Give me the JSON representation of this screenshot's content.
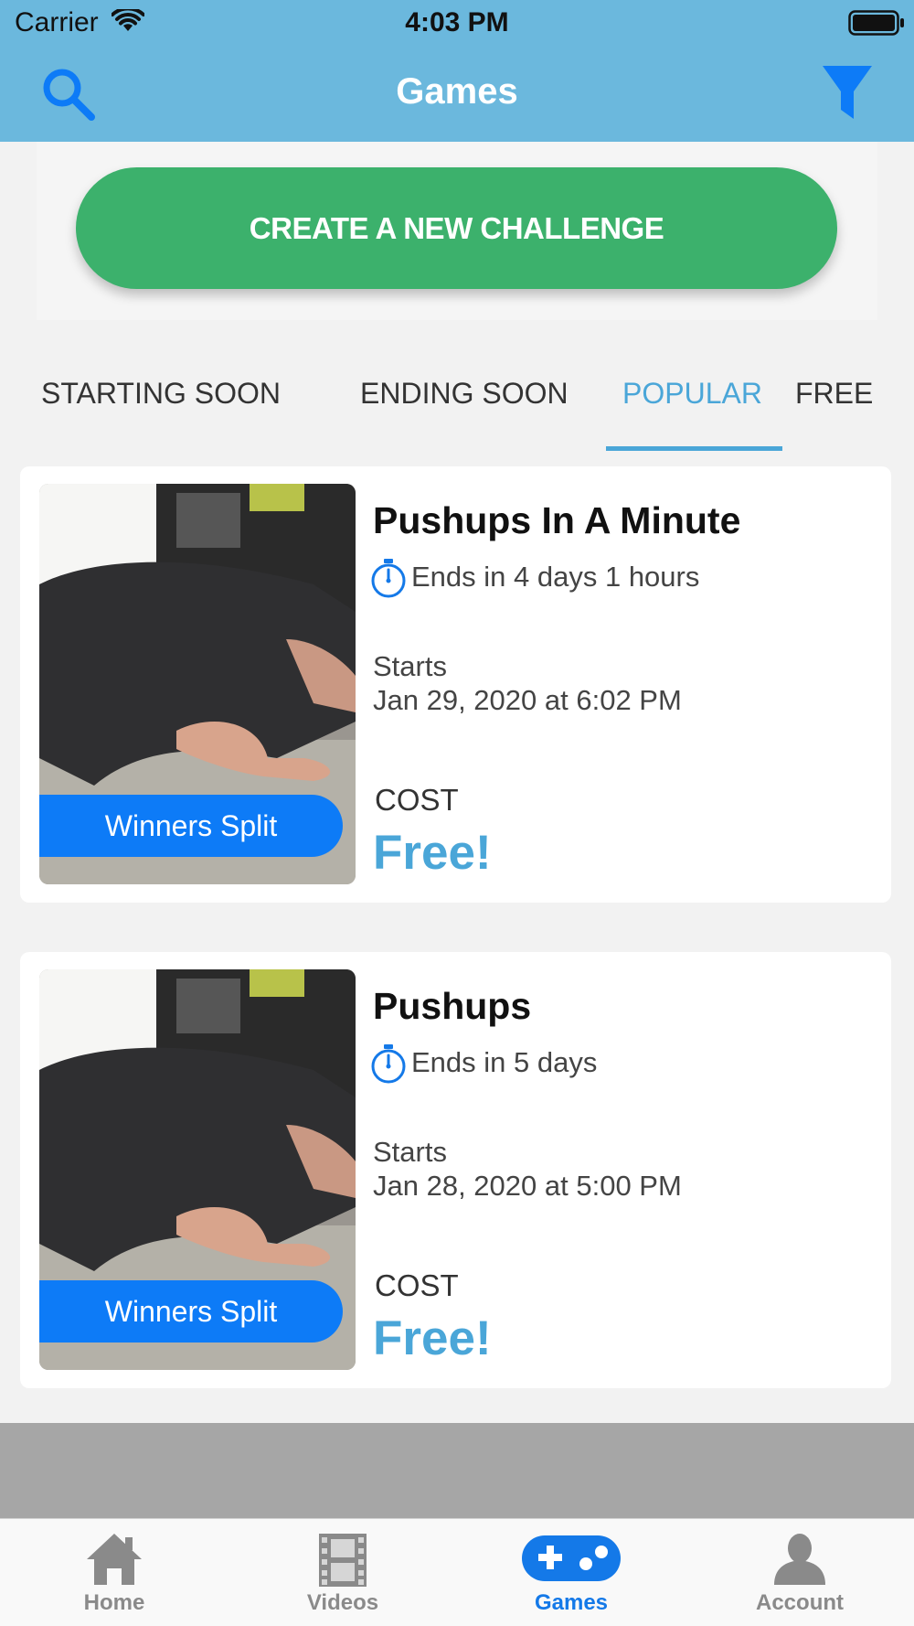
{
  "status_bar": {
    "carrier": "Carrier",
    "time": "4:03 PM"
  },
  "header": {
    "title": "Games",
    "left_icon": "search-icon",
    "right_icon": "filter-icon"
  },
  "cta": {
    "label": "CREATE A NEW CHALLENGE"
  },
  "tabs": [
    {
      "label": "STARTING SOON",
      "active": false
    },
    {
      "label": "ENDING SOON",
      "active": false
    },
    {
      "label": "POPULAR",
      "active": true
    },
    {
      "label": "FREE",
      "active": false
    }
  ],
  "games": [
    {
      "title": "Pushups In A Minute",
      "ends": "Ends in 4 days 1 hours",
      "starts_label": "Starts",
      "starts_date": "Jan 29, 2020 at 6:02 PM",
      "badge": "Winners Split",
      "cost_label": "COST",
      "cost_value": "Free!"
    },
    {
      "title": "Pushups",
      "ends": "Ends in 5 days",
      "starts_label": "Starts",
      "starts_date": "Jan 28, 2020 at 5:00 PM",
      "badge": "Winners Split",
      "cost_label": "COST",
      "cost_value": "Free!"
    }
  ],
  "tabbar": [
    {
      "label": "Home",
      "icon": "home-icon",
      "active": false
    },
    {
      "label": "Videos",
      "icon": "film-icon",
      "active": false
    },
    {
      "label": "Games",
      "icon": "gamepad-icon",
      "active": true
    },
    {
      "label": "Account",
      "icon": "person-icon",
      "active": false
    }
  ],
  "colors": {
    "header": "#6bb8dd",
    "cta": "#3cb16c",
    "accent": "#4aa6d8",
    "badge": "#0d7bf7",
    "tab_active": "#1479e8"
  }
}
